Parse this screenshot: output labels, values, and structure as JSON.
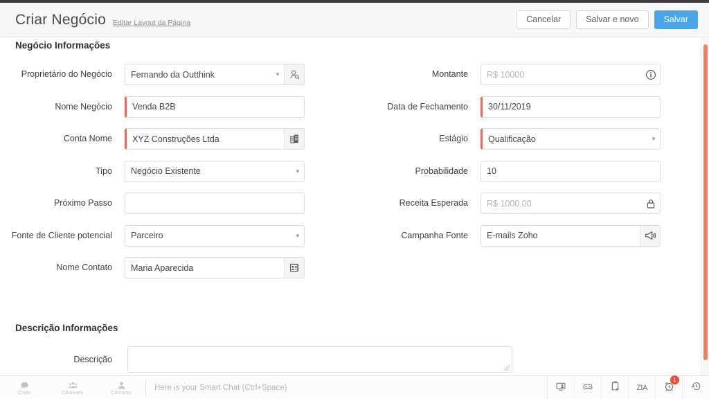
{
  "header": {
    "title": "Criar Negócio",
    "edit_layout_link": "Editar Layout da Página",
    "buttons": {
      "cancel": "Cancelar",
      "save_and_new": "Salvar e novo",
      "save": "Salvar"
    },
    "accent_primary": "#49a5e8"
  },
  "sections": {
    "deal_info_title": "Negócio Informações",
    "description_info_title": "Descrição Informações"
  },
  "colors": {
    "required_marker": "#f0655a",
    "scrollbar_thumb": "#e8836a",
    "label_text": "#3f3f44",
    "value_text": "#44454a",
    "placeholder_text": "#b4b4b4"
  },
  "left_fields": [
    {
      "label": "Proprietário do Negócio",
      "value": "Fernando da Outthink",
      "placeholder": "",
      "required": false,
      "control": "picklist-lookup",
      "icon": "user-search-icon"
    },
    {
      "label": "Nome Negócio",
      "value": "Venda B2B",
      "placeholder": "",
      "required": true,
      "control": "text",
      "icon": ""
    },
    {
      "label": "Conta Nome",
      "value": "XYZ Construções Ltda",
      "placeholder": "",
      "required": true,
      "control": "lookup",
      "icon": "building-icon"
    },
    {
      "label": "Tipo",
      "value": "Negócio Existente",
      "placeholder": "",
      "required": false,
      "control": "picklist",
      "icon": ""
    },
    {
      "label": "Próximo Passo",
      "value": "",
      "placeholder": "",
      "required": false,
      "control": "text",
      "icon": ""
    },
    {
      "label": "Fonte de Cliente potencial",
      "value": "Parceiro",
      "placeholder": "",
      "required": false,
      "control": "picklist",
      "icon": ""
    },
    {
      "label": "Nome Contato",
      "value": "Maria Aparecida",
      "placeholder": "",
      "required": false,
      "control": "lookup",
      "icon": "contact-card-icon"
    }
  ],
  "right_fields": [
    {
      "label": "Montante",
      "value": "",
      "placeholder": "R$ 10000",
      "required": false,
      "control": "text",
      "icon": "info-icon"
    },
    {
      "label": "Data de Fechamento",
      "value": "30/11/2019",
      "placeholder": "",
      "required": true,
      "control": "date",
      "icon": ""
    },
    {
      "label": "Estágio",
      "value": "Qualificação",
      "placeholder": "",
      "required": true,
      "control": "picklist",
      "icon": ""
    },
    {
      "label": "Probabilidade",
      "value": "10",
      "placeholder": "",
      "required": false,
      "control": "text",
      "icon": ""
    },
    {
      "label": "Receita Esperada",
      "value": "",
      "placeholder": "R$ 1000.00",
      "required": false,
      "control": "readonly",
      "icon": "lock-icon"
    },
    {
      "label": "Campanha Fonte",
      "value": "E-mails Zoho",
      "placeholder": "",
      "required": false,
      "control": "lookup",
      "icon": "megaphone-icon"
    }
  ],
  "description_field": {
    "label": "Descrição",
    "value": "",
    "placeholder": ""
  },
  "chatbar": {
    "tabs": [
      {
        "label": "Chats",
        "icon": "chat-bubble-icon"
      },
      {
        "label": "Channels",
        "icon": "channels-group-icon"
      },
      {
        "label": "Contacts",
        "icon": "contact-person-icon"
      }
    ],
    "input_placeholder": "Here is your Smart Chat (Ctrl+Space)",
    "actions": [
      {
        "name": "screen-share-icon",
        "badge": ""
      },
      {
        "name": "gamepad-icon",
        "badge": ""
      },
      {
        "name": "clipboard-icon",
        "badge": ""
      },
      {
        "name": "zia-icon",
        "badge": "",
        "text": "ZIA"
      },
      {
        "name": "alarm-clock-icon",
        "badge": "1"
      },
      {
        "name": "history-clock-icon",
        "badge": ""
      }
    ]
  }
}
